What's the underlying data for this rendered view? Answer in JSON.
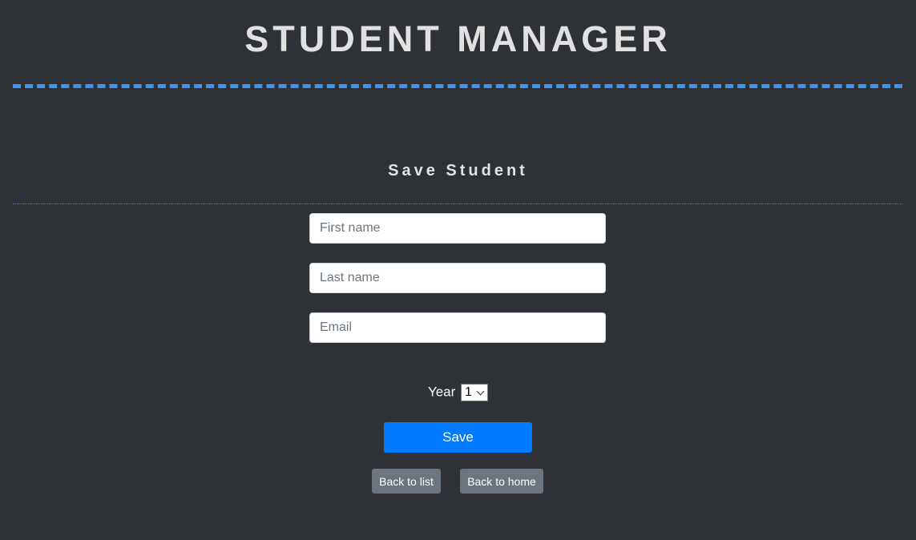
{
  "header": {
    "title": "STUDENT MANAGER"
  },
  "form": {
    "title": "Save Student",
    "first_name": {
      "placeholder": "First name",
      "value": ""
    },
    "last_name": {
      "placeholder": "Last name",
      "value": ""
    },
    "email": {
      "placeholder": "Email",
      "value": ""
    },
    "year": {
      "label": "Year",
      "selected": "1"
    },
    "save_label": "Save"
  },
  "nav": {
    "back_to_list": "Back to list",
    "back_to_home": "Back to home"
  },
  "colors": {
    "background": "#2e3135",
    "accent": "#3b95f5",
    "primary_button": "#007bff",
    "secondary_button": "#6c757d"
  }
}
